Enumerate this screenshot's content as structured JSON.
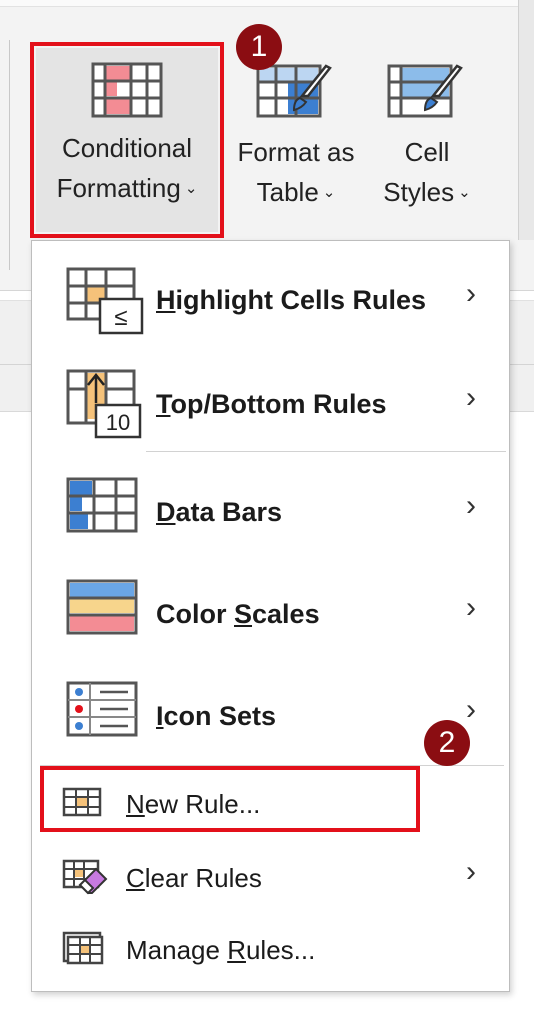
{
  "ribbon": {
    "conditional_formatting": {
      "line1": "Conditional",
      "line2": "Formatting"
    },
    "format_as_table": {
      "line1": "Format as",
      "line2": "Table"
    },
    "cell_styles": {
      "line1": "Cell",
      "line2": "Styles"
    },
    "chevron": "⌄"
  },
  "badges": {
    "step1": "1",
    "step2": "2"
  },
  "menu": {
    "items": [
      {
        "pre": "",
        "u": "H",
        "post": "ighlight Cells Rules",
        "submenu": true,
        "icon": "highlight-cells-icon"
      },
      {
        "pre": "",
        "u": "T",
        "post": "op/Bottom Rules",
        "submenu": true,
        "icon": "top-bottom-icon"
      },
      {
        "pre": "",
        "u": "D",
        "post": "ata Bars",
        "submenu": true,
        "icon": "data-bars-icon"
      },
      {
        "pre": "Color ",
        "u": "S",
        "post": "cales",
        "submenu": true,
        "icon": "color-scales-icon"
      },
      {
        "pre": "",
        "u": "I",
        "post": "con Sets",
        "submenu": true,
        "icon": "icon-sets-icon"
      },
      {
        "pre": "",
        "u": "N",
        "post": "ew Rule...",
        "submenu": false,
        "icon": "new-rule-icon"
      },
      {
        "pre": "",
        "u": "C",
        "post": "lear Rules",
        "submenu": true,
        "icon": "clear-rules-icon"
      },
      {
        "pre": "Manage ",
        "u": "R",
        "post": "ules...",
        "submenu": false,
        "icon": "manage-rules-icon"
      }
    ],
    "arrow": "›",
    "top_bottom_icon_number": "10"
  },
  "colors": {
    "highlight": "#e3101a",
    "badge": "#8b0d12",
    "accent_blue": "#3c7fd1",
    "accent_orange": "#f5c27a",
    "accent_red": "#f38c94"
  }
}
